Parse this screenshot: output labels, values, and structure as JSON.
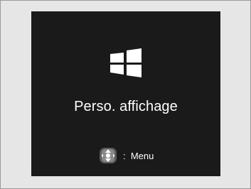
{
  "screen": {
    "title": "Perso. affichage",
    "display_icon": "display-screens-icon",
    "hint": {
      "icon": "selector-knob-icon",
      "label": ":  Menu"
    }
  },
  "colors": {
    "screen_background": "#1a1a1a",
    "outer_background": "#e6e6e6",
    "foreground": "#ffffff"
  }
}
